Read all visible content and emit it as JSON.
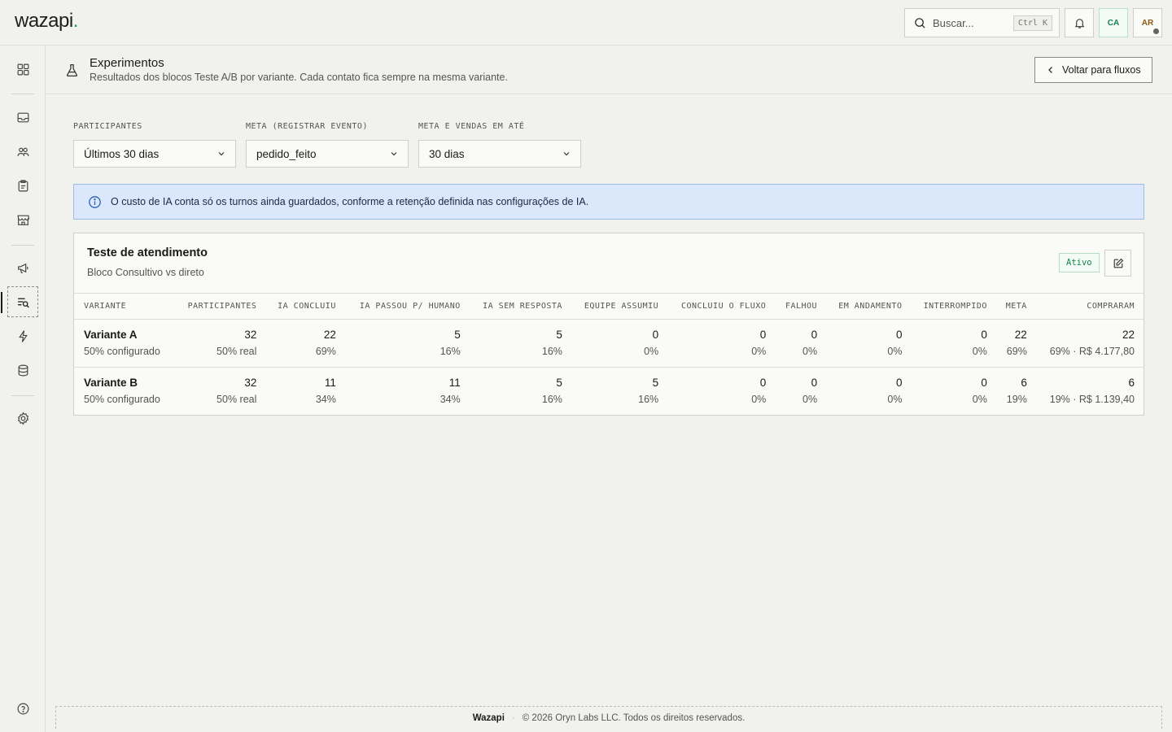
{
  "app": {
    "logo": "wazapi",
    "logo_dot": "."
  },
  "topbar": {
    "search_placeholder": "Buscar...",
    "search_shortcut": "Ctrl K",
    "avatar_ca": "CA",
    "avatar_ar": "AR"
  },
  "sidebar": {
    "items": [
      "grid-icon",
      "inbox-icon",
      "users-icon",
      "clipboard-icon",
      "store-icon",
      "megaphone-icon",
      "experiments-icon",
      "bolt-icon",
      "database-icon",
      "settings-icon",
      "help-icon"
    ],
    "active": "experiments-icon"
  },
  "header": {
    "title": "Experimentos",
    "subtitle": "Resultados dos blocos Teste A/B por variante. Cada contato fica sempre na mesma variante.",
    "back_label": "Voltar para fluxos"
  },
  "filters": [
    {
      "label": "PARTICIPANTES",
      "value": "Últimos 30 dias"
    },
    {
      "label": "META (REGISTRAR EVENTO)",
      "value": "pedido_feito"
    },
    {
      "label": "META E VENDAS EM ATÉ",
      "value": "30 dias"
    }
  ],
  "banner": {
    "text": "O custo de IA conta só os turnos ainda guardados, conforme a retenção definida nas configurações de IA."
  },
  "card": {
    "title": "Teste de atendimento",
    "subtitle": "Bloco Consultivo vs direto",
    "status": "Ativo",
    "columns": [
      "VARIANTE",
      "PARTICIPANTES",
      "IA CONCLUIU",
      "IA PASSOU P/ HUMANO",
      "IA SEM RESPOSTA",
      "EQUIPE ASSUMIU",
      "CONCLUIU O FLUXO",
      "FALHOU",
      "EM ANDAMENTO",
      "INTERROMPIDO",
      "META",
      "COMPRARAM"
    ],
    "rows": [
      {
        "name": "Variante A",
        "config": "50% configurado",
        "cells": [
          [
            "32",
            "50% real"
          ],
          [
            "22",
            "69%"
          ],
          [
            "5",
            "16%"
          ],
          [
            "5",
            "16%"
          ],
          [
            "0",
            "0%"
          ],
          [
            "0",
            "0%"
          ],
          [
            "0",
            "0%"
          ],
          [
            "0",
            "0%"
          ],
          [
            "0",
            "0%"
          ],
          [
            "22",
            "69%"
          ],
          [
            "22",
            "69% · R$ 4.177,80"
          ]
        ]
      },
      {
        "name": "Variante B",
        "config": "50% configurado",
        "cells": [
          [
            "32",
            "50% real"
          ],
          [
            "11",
            "34%"
          ],
          [
            "11",
            "34%"
          ],
          [
            "5",
            "16%"
          ],
          [
            "5",
            "16%"
          ],
          [
            "0",
            "0%"
          ],
          [
            "0",
            "0%"
          ],
          [
            "0",
            "0%"
          ],
          [
            "0",
            "0%"
          ],
          [
            "6",
            "19%"
          ],
          [
            "6",
            "19% · R$ 1.139,40"
          ]
        ]
      }
    ]
  },
  "footer": {
    "brand": "Wazapi",
    "text": "© 2026 Oryn Labs LLC. Todos os direitos reservados."
  }
}
